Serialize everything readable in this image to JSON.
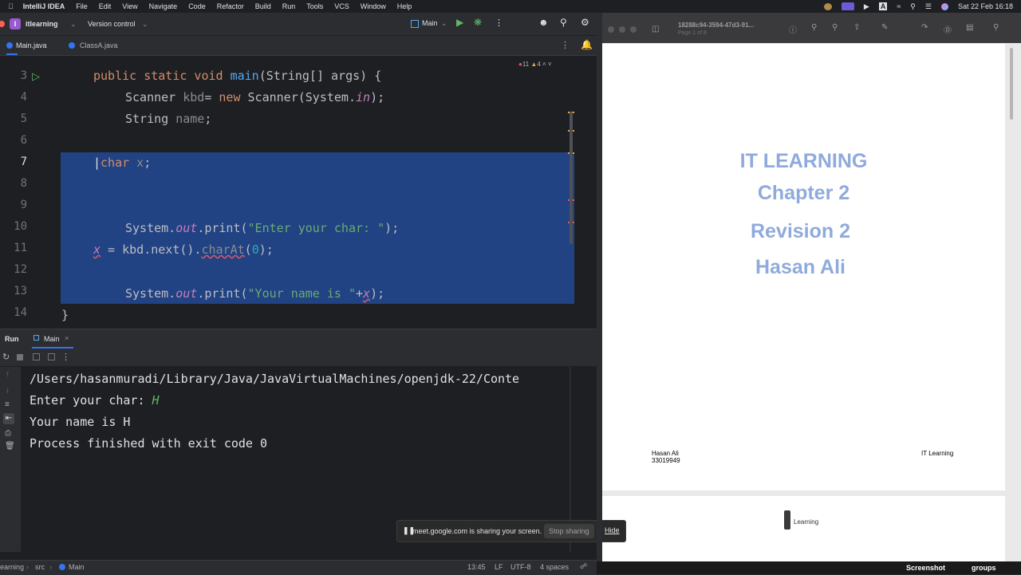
{
  "menubar": {
    "app_name": "IntelliJ IDEA",
    "items": [
      "File",
      "Edit",
      "View",
      "Navigate",
      "Code",
      "Refactor",
      "Build",
      "Run",
      "Tools",
      "VCS",
      "Window",
      "Help"
    ],
    "datetime": "Sat 22 Feb  16:18"
  },
  "titlebar": {
    "project_badge": "I",
    "project": "itlearning",
    "vcs": "Version control",
    "run_config": "Main"
  },
  "tabs": [
    {
      "label": "Main.java"
    },
    {
      "label": "ClassA.java"
    }
  ],
  "editor": {
    "inspection_errors": "11",
    "inspection_warnings": "4",
    "lines": [
      {
        "num": "3"
      },
      {
        "num": "4"
      },
      {
        "num": "5"
      },
      {
        "num": "6"
      },
      {
        "num": "7"
      },
      {
        "num": "8"
      },
      {
        "num": "9"
      },
      {
        "num": "10"
      },
      {
        "num": "11"
      },
      {
        "num": "12"
      },
      {
        "num": "13"
      },
      {
        "num": "14"
      }
    ],
    "code": {
      "l3_kw": "public static void ",
      "l3_fn": "main",
      "l3_rest": "(String[] args) {",
      "l4_a": "Scanner ",
      "l4_var": "kbd",
      "l4_b": "= ",
      "l4_kw": "new",
      "l4_c": " Scanner(System.",
      "l4_in": "in",
      "l4_d": ");",
      "l5_a": "String ",
      "l5_var": "name",
      "l5_b": ";",
      "l7_kw": "char",
      "l7_var": " x",
      "l7_b": ";",
      "l10_a": "System.",
      "l10_out": "out",
      "l10_b": ".print(",
      "l10_str": "\"Enter your char: \"",
      "l10_c": ");",
      "l11_a": "x",
      "l11_b": " = kbd.next().",
      "l11_fn": "charAt",
      "l11_c": "(",
      "l11_num": "0",
      "l11_d": ");",
      "l13_a": "System.",
      "l13_out": "out",
      "l13_b": ".print(",
      "l13_str": "\"Your name is \"",
      "l13_c": "+",
      "l13_x": "x",
      "l13_d": ");",
      "l14": "}"
    }
  },
  "run_panel": {
    "run_label": "Run",
    "tab": "Main",
    "console": [
      "/Users/hasanmuradi/Library/Java/JavaVirtualMachines/openjdk-22/Conte",
      "Enter your char: ",
      "Your name is H",
      "Process finished with exit code 0"
    ],
    "user_input": "H"
  },
  "statusbar": {
    "crumbs": [
      "earning",
      "src",
      "Main"
    ],
    "position": "13:45",
    "line_sep": "LF",
    "encoding": "UTF-8",
    "indent": "4 spaces"
  },
  "preview": {
    "file_title": "18288c94-3594-47d3-91...",
    "page_info": "Page 1 of 8",
    "heading1": "IT LEARNING",
    "heading2": "Chapter 2",
    "heading3": "Revision 2",
    "heading4": "Hasan Ali",
    "footer_name": "Hasan Ali",
    "footer_id": "33019949",
    "footer_right": "IT Learning",
    "logo_text": "Learning"
  },
  "share": {
    "message": "meet.google.com is sharing your screen.",
    "stop": "Stop sharing",
    "hide": "Hide"
  },
  "dock": {
    "screenshot": "Screenshot",
    "groups": "groups"
  },
  "colors": {
    "accent": "#214283",
    "title_blue": "#8faadc"
  }
}
